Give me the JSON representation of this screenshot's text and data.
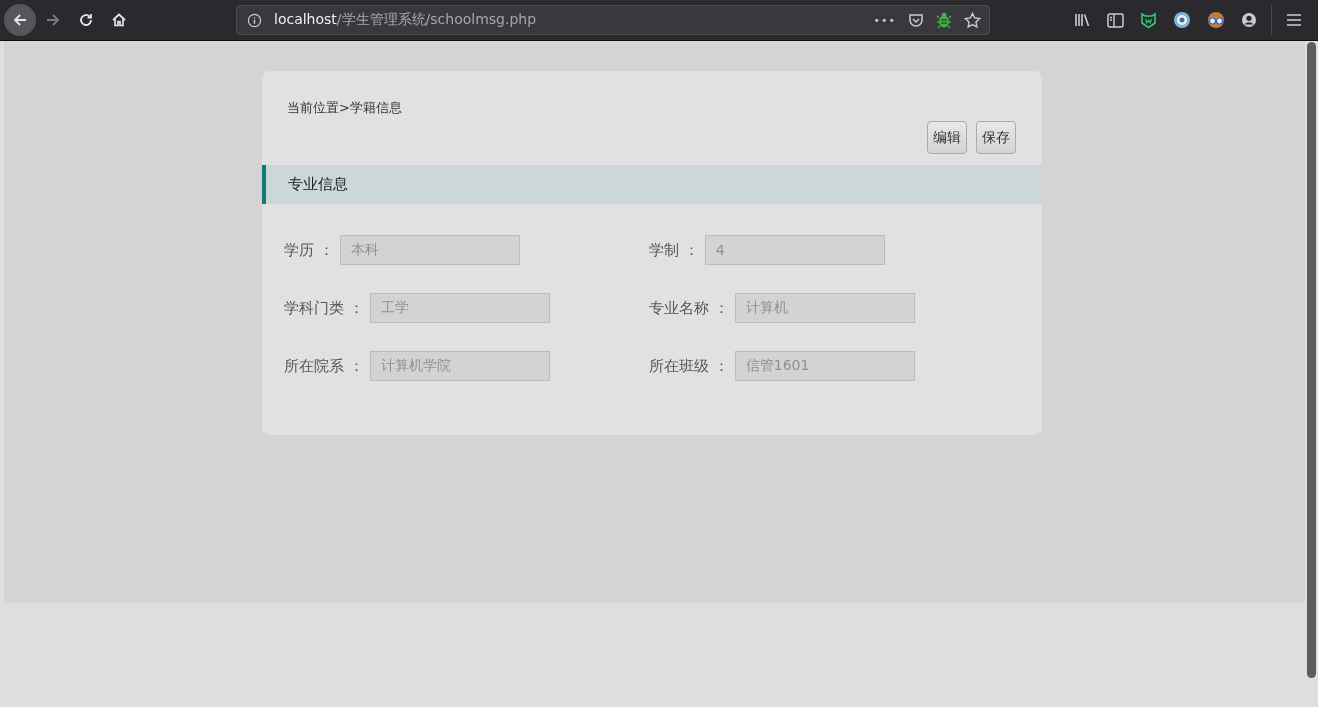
{
  "browser": {
    "back_disabled": false,
    "forward_disabled": true,
    "url_host": "localhost",
    "url_path": "/学生管理系统/schoolmsg.php",
    "page_actions": "•••"
  },
  "breadcrumb": "当前位置>学籍信息",
  "buttons": [
    "编辑",
    "保存"
  ],
  "section": {
    "title": "专业信息"
  },
  "fields": [
    {
      "label": "学历 ：",
      "value": "本科",
      "disabled": true
    },
    {
      "label": "学制 ：",
      "value": "4",
      "disabled": true
    },
    {
      "label": "学科门类 ：",
      "value": "工学",
      "disabled": true
    },
    {
      "label": "专业名称 ：",
      "value": "计算机",
      "disabled": true
    },
    {
      "label": "所在院系 ：",
      "value": "计算机学院",
      "disabled": true
    },
    {
      "label": "所在班级 ：",
      "value": "信管1601",
      "disabled": true
    }
  ]
}
